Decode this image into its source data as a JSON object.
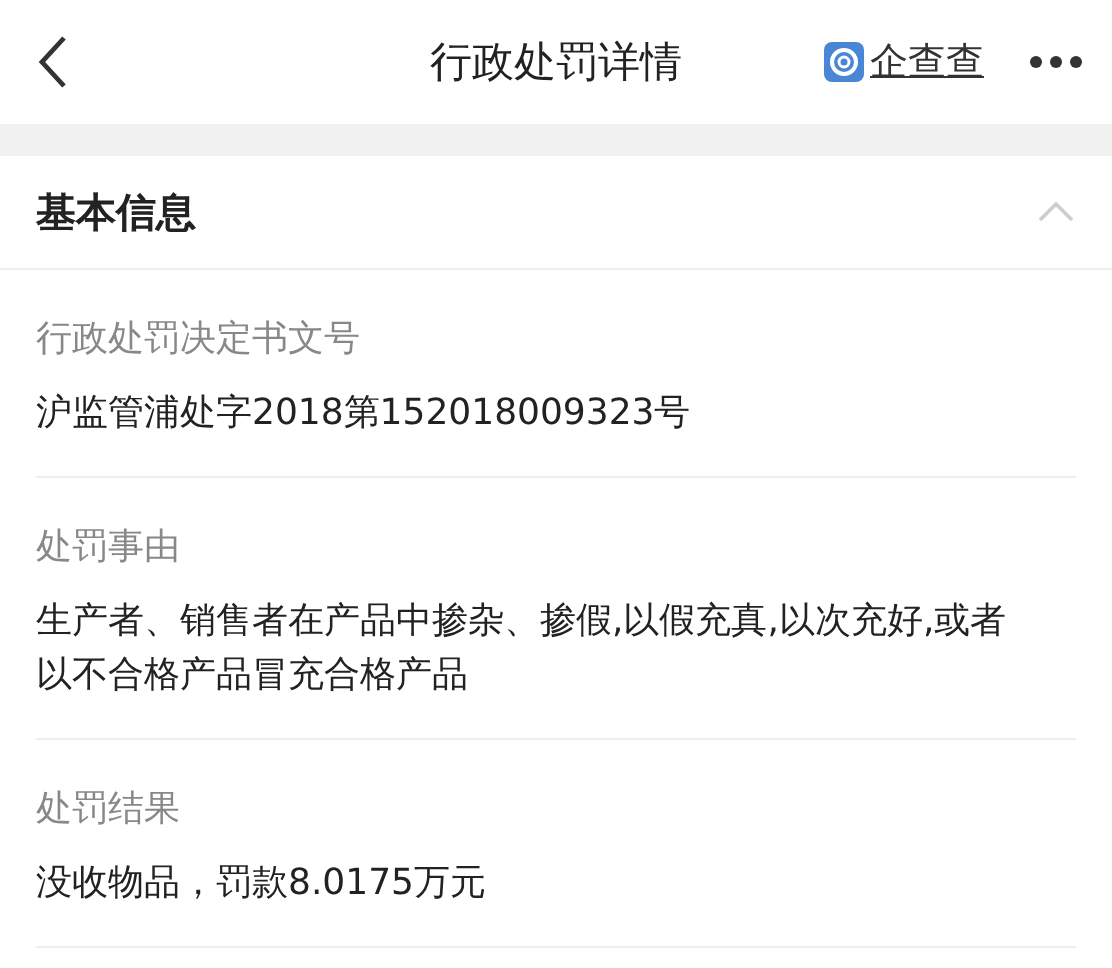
{
  "header": {
    "title": "行政处罚详情",
    "brand": "企查查"
  },
  "section": {
    "title": "基本信息",
    "expanded": true,
    "fields": [
      {
        "label": "行政处罚决定书文号",
        "value": "沪监管浦处字2018第152018009323号"
      },
      {
        "label": "处罚事由",
        "value": "生产者、销售者在产品中掺杂、掺假,以假充真,以次充好,或者以不合格产品冒充合格产品"
      },
      {
        "label": "处罚结果",
        "value": "没收物品，罚款8.0175万元"
      }
    ]
  }
}
